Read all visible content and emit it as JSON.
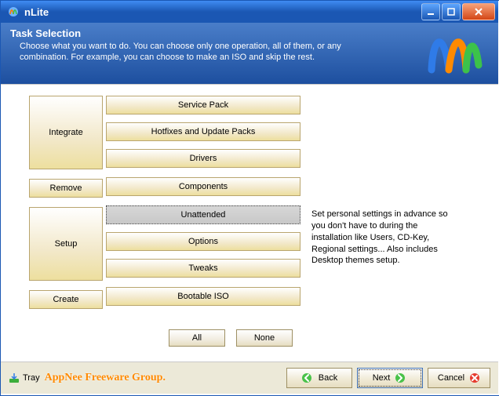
{
  "window": {
    "title": "nLite"
  },
  "header": {
    "title": "Task Selection",
    "description": "Choose what you want to do. You can choose only one operation, all of them, or any combination. For example, you can choose to make an ISO and skip the rest."
  },
  "categories": {
    "integrate": "Integrate",
    "remove": "Remove",
    "setup": "Setup",
    "create": "Create"
  },
  "tasks": {
    "service_pack": "Service Pack",
    "hotfixes": "Hotfixes and Update Packs",
    "drivers": "Drivers",
    "components": "Components",
    "unattended": "Unattended",
    "options": "Options",
    "tweaks": "Tweaks",
    "bootable_iso": "Bootable ISO"
  },
  "hint": "Set personal settings in advance so you don't have to during the installation like Users, CD-Key, Regional settings... Also includes Desktop themes setup.",
  "filters": {
    "all": "All",
    "none": "None"
  },
  "footer": {
    "tray": "Tray",
    "watermark": "AppNee Freeware Group.",
    "back": "Back",
    "next": "Next",
    "cancel": "Cancel"
  }
}
